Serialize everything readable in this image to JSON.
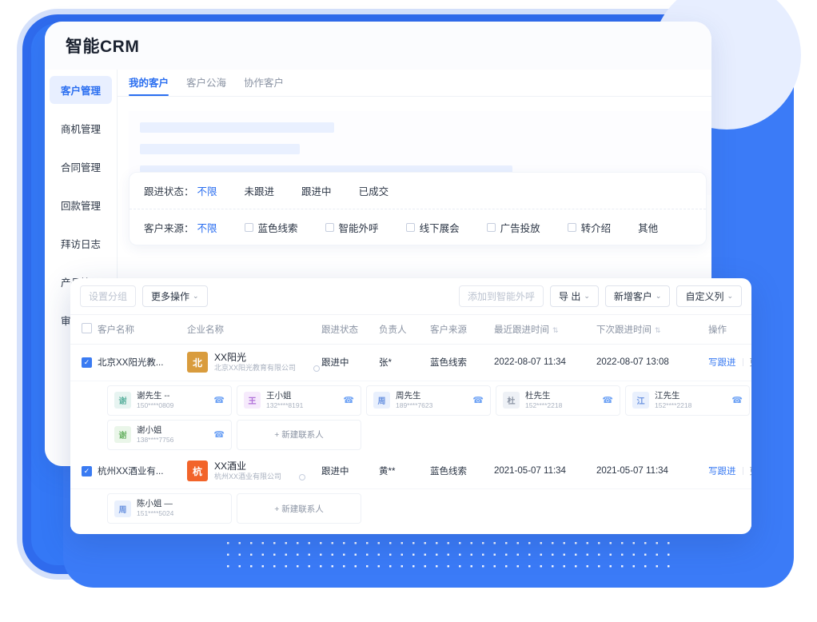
{
  "app": {
    "title": "智能CRM",
    "sidebar": [
      {
        "label": "客户管理",
        "active": true
      },
      {
        "label": "商机管理",
        "active": false
      },
      {
        "label": "合同管理",
        "active": false
      },
      {
        "label": "回款管理",
        "active": false
      },
      {
        "label": "拜访日志",
        "active": false
      },
      {
        "label": "产品管理",
        "active": false
      },
      {
        "label": "审批管理",
        "active": false
      }
    ],
    "tabs": [
      {
        "label": "我的客户",
        "active": true
      },
      {
        "label": "客户公海",
        "active": false
      },
      {
        "label": "协作客户",
        "active": false
      }
    ],
    "filters": [
      {
        "label": "跟进状态：",
        "active_value": "不限",
        "options": [
          {
            "text": "未跟进",
            "checkbox": false
          },
          {
            "text": "跟进中",
            "checkbox": false
          },
          {
            "text": "已成交",
            "checkbox": false
          }
        ]
      },
      {
        "label": "客户来源：",
        "active_value": "不限",
        "options": [
          {
            "text": "蓝色线索",
            "checkbox": true
          },
          {
            "text": "智能外呼",
            "checkbox": true
          },
          {
            "text": "线下展会",
            "checkbox": true
          },
          {
            "text": "广告投放",
            "checkbox": true
          },
          {
            "text": "转介绍",
            "checkbox": true
          },
          {
            "text": "其他",
            "checkbox": false
          }
        ]
      }
    ]
  },
  "toolbar": {
    "left": [
      {
        "label": "设置分组",
        "disabled": true,
        "caret": false
      },
      {
        "label": "更多操作",
        "disabled": false,
        "caret": true
      }
    ],
    "right": [
      {
        "label": "添加到智能外呼",
        "disabled": true,
        "caret": false
      },
      {
        "label": "导 出",
        "disabled": false,
        "caret": true
      },
      {
        "label": "新增客户",
        "disabled": false,
        "caret": true
      },
      {
        "label": "自定义列",
        "disabled": false,
        "caret": true
      }
    ]
  },
  "table": {
    "columns": [
      {
        "label": "客户名称",
        "sortable": false
      },
      {
        "label": "企业名称",
        "sortable": false
      },
      {
        "label": "跟进状态",
        "sortable": false
      },
      {
        "label": "负责人",
        "sortable": false
      },
      {
        "label": "客户来源",
        "sortable": false
      },
      {
        "label": "最近跟进时间",
        "sortable": true
      },
      {
        "label": "下次跟进时间",
        "sortable": true
      },
      {
        "label": "操作",
        "sortable": false
      }
    ],
    "action_primary": "写跟进",
    "action_secondary": "更多",
    "add_contact_label": "+ 新建联系人",
    "rows": [
      {
        "checked": true,
        "customer_name": "北京XX阳光教...",
        "company_avatar": "北",
        "company_avatar_color": "#d99c3d",
        "company_name": "XX阳光",
        "company_full": "北京XX阳光教育有限公司",
        "status": "跟进中",
        "owner": "张*",
        "source": "蓝色线索",
        "last_follow": "2022-08-07 11:34",
        "next_follow": "2022-08-07 13:08",
        "contacts": [
          {
            "avatar": "谢",
            "avatar_bg": "#e7f4f1",
            "avatar_fg": "#5fb3a1",
            "name": "谢先生 --",
            "phone": "150****0809",
            "has_phone_icon": true
          },
          {
            "avatar": "王",
            "avatar_bg": "#f6eafc",
            "avatar_fg": "#b070d8",
            "name": "王小姐",
            "phone": "132****8191",
            "has_phone_icon": true
          },
          {
            "avatar": "周",
            "avatar_bg": "#e9f0fd",
            "avatar_fg": "#6b93e0",
            "name": "周先生",
            "phone": "189****7623",
            "has_phone_icon": true
          },
          {
            "avatar": "杜",
            "avatar_bg": "#eef1f6",
            "avatar_fg": "#8a93a3",
            "name": "杜先生",
            "phone": "152****2218",
            "has_phone_icon": true
          },
          {
            "avatar": "江",
            "avatar_bg": "#e9f0fd",
            "avatar_fg": "#6b93e0",
            "name": "江先生",
            "phone": "152****2218",
            "has_phone_icon": true
          },
          {
            "avatar": "谢",
            "avatar_bg": "#eaf6e9",
            "avatar_fg": "#6fb56a",
            "name": "谢小姐",
            "phone": "138****7756",
            "has_phone_icon": true
          }
        ]
      },
      {
        "checked": true,
        "customer_name": "杭州XX酒业有...",
        "company_avatar": "杭",
        "company_avatar_color": "#f2642a",
        "company_name": "XX酒业",
        "company_full": "杭州XX酒业有限公司",
        "status": "跟进中",
        "owner": "黄**",
        "source": "蓝色线索",
        "last_follow": "2021-05-07 11:34",
        "next_follow": "2021-05-07 11:34",
        "contacts": [
          {
            "avatar": "周",
            "avatar_bg": "#e9f0fd",
            "avatar_fg": "#6b93e0",
            "name": "陈小姐 —",
            "phone": "151****5024",
            "has_phone_icon": false
          }
        ]
      }
    ]
  },
  "colors": {
    "brand_blue": "#2a6ef0",
    "frame_blue": "#2f6bed",
    "panel_blue": "#3b7bf7",
    "deco_circle": "#e7eeff"
  },
  "skeleton_bar_widths": [
    "243px",
    "200px",
    "466px"
  ]
}
